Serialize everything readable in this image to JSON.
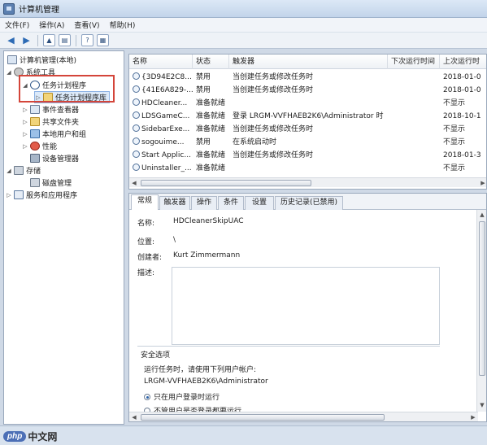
{
  "window": {
    "title": "计算机管理"
  },
  "menu": [
    "文件(F)",
    "操作(A)",
    "查看(V)",
    "帮助(H)"
  ],
  "tree": {
    "root": "计算机管理(本地)",
    "system_tools": "系统工具",
    "task_scheduler": "任务计划程序",
    "task_scheduler_library": "任务计划程序库",
    "event_viewer": "事件查看器",
    "shared_folders": "共享文件夹",
    "local_users_groups": "本地用户和组",
    "performance": "性能",
    "device_manager": "设备管理器",
    "storage": "存储",
    "disk_management": "磁盘管理",
    "services_apps": "服务和应用程序"
  },
  "task_list": {
    "columns": [
      "名称",
      "状态",
      "触发器",
      "下次运行时间",
      "上次运行时"
    ],
    "rows": [
      {
        "name": "{3D94E2C8...",
        "status": "禁用",
        "trigger": "当创建任务或修改任务时",
        "next_run": "",
        "last_run": "2018-01-0"
      },
      {
        "name": "{41E6A829-...",
        "status": "禁用",
        "trigger": "当创建任务或修改任务时",
        "next_run": "",
        "last_run": "2018-01-0"
      },
      {
        "name": "HDCleaner...",
        "status": "准备就绪",
        "trigger": "",
        "next_run": "",
        "last_run": "不显示"
      },
      {
        "name": "LDSGameC...",
        "status": "准备就绪",
        "trigger": "登录 LRGM-VVFHAEB2K6\\Administrator 时",
        "next_run": "",
        "last_run": "2018-10-1"
      },
      {
        "name": "SidebarExe...",
        "status": "准备就绪",
        "trigger": "当创建任务或修改任务时",
        "next_run": "",
        "last_run": "不显示"
      },
      {
        "name": "sogouime...",
        "status": "禁用",
        "trigger": "在系统启动时",
        "next_run": "",
        "last_run": "不显示"
      },
      {
        "name": "Start Applic...",
        "status": "准备就绪",
        "trigger": "当创建任务或修改任务时",
        "next_run": "",
        "last_run": "2018-01-3"
      },
      {
        "name": "Uninstaller_...",
        "status": "准备就绪",
        "trigger": "",
        "next_run": "",
        "last_run": "不显示"
      }
    ]
  },
  "detail": {
    "tabs": [
      "常规",
      "触发器",
      "操作",
      "条件",
      "设置",
      "历史记录(已禁用)"
    ],
    "name_label": "名称:",
    "name_value": "HDCleanerSkipUAC",
    "location_label": "位置:",
    "location_value": "\\",
    "author_label": "创建者:",
    "author_value": "Kurt Zimmermann",
    "description_label": "描述:",
    "security_options": "安全选项",
    "run_as_label": "运行任务时，请使用下列用户帐户:",
    "run_as_value": "LRGM-VVFHAEB2K6\\Administrator",
    "radio_logged_on": "只在用户登录时运行",
    "radio_whether": "不管用户是否登录都要运行"
  },
  "watermark": {
    "brand": "php",
    "suffix": "中文网"
  }
}
